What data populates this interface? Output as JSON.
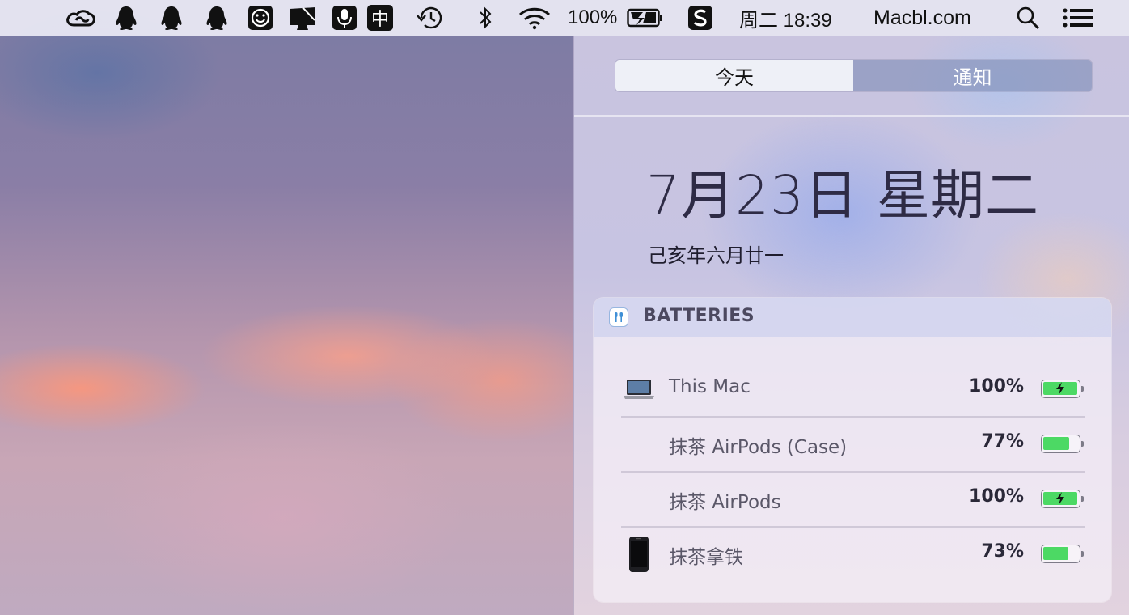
{
  "menubar": {
    "battery_percent": "100%",
    "clock": "周二 18:39",
    "site": "Macbl.com",
    "ime_label": "中",
    "icons": [
      "creative-cloud-icon",
      "qq-icon",
      "qq-icon",
      "qq-icon",
      "smiley-icon",
      "display-icon",
      "microphone-icon",
      "input-method-icon",
      "time-machine-icon",
      "bluetooth-icon",
      "wifi-icon",
      "battery-charging-icon",
      "sogou-icon",
      "spotlight-icon",
      "notification-center-icon"
    ]
  },
  "notification_center": {
    "tabs": {
      "today": "今天",
      "notifications": "通知"
    },
    "active_tab": "today",
    "date": "7月23日 星期二",
    "lunar_date": "己亥年六月廿一"
  },
  "widget": {
    "title": "BATTERIES",
    "icon": "airpods-icon",
    "accent_color": "#4cd964",
    "devices": [
      {
        "name": "This Mac",
        "percent": "100%",
        "level": 1.0,
        "charging": true,
        "icon": "laptop-icon"
      },
      {
        "name": "抹茶 AirPods (Case)",
        "percent": "77%",
        "level": 0.77,
        "charging": false,
        "icon": ""
      },
      {
        "name": "抹茶 AirPods",
        "percent": "100%",
        "level": 1.0,
        "charging": true,
        "icon": ""
      },
      {
        "name": "抹茶拿铁",
        "percent": "73%",
        "level": 0.73,
        "charging": false,
        "icon": "iphone-icon"
      }
    ]
  }
}
